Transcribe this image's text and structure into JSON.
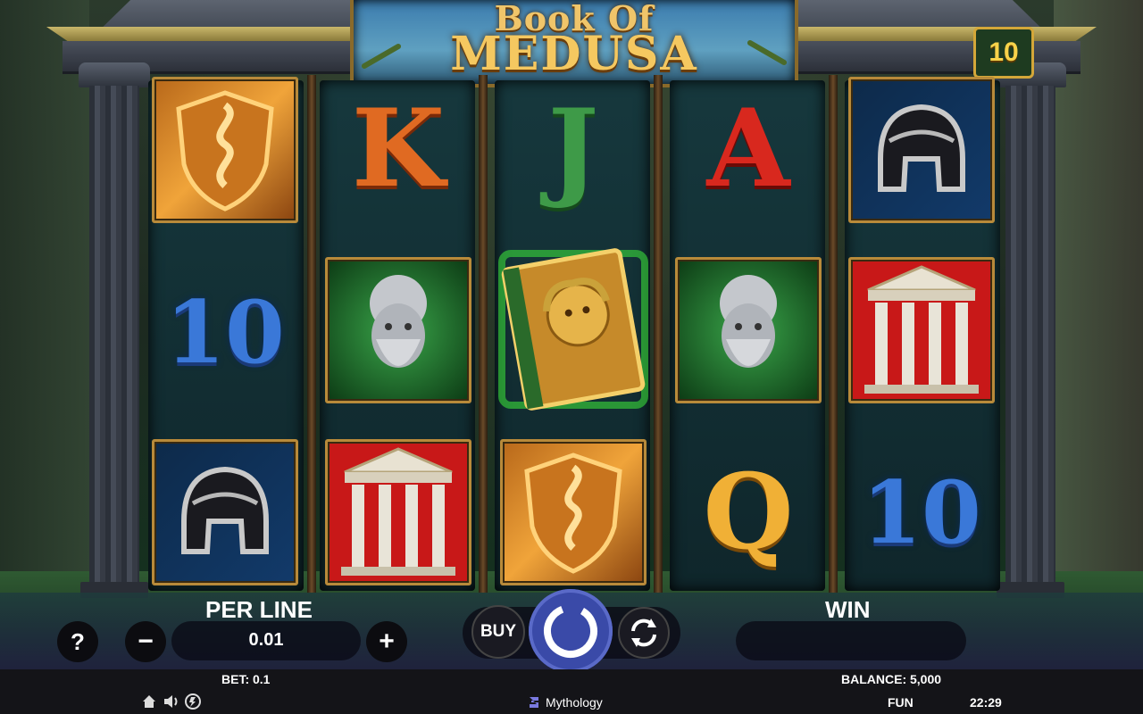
{
  "game": {
    "title_line1": "Book Of",
    "title_line2": "MEDUSA",
    "lines_count": "10"
  },
  "reels": [
    [
      "shield",
      "ten",
      "helmet"
    ],
    [
      "K",
      "bust",
      "temple"
    ],
    [
      "J",
      "book",
      "shield"
    ],
    [
      "A",
      "bust",
      "Q"
    ],
    [
      "helmet",
      "temple",
      "ten"
    ]
  ],
  "symbols": {
    "ten_label": "10"
  },
  "controls": {
    "help_label": "?",
    "minus_label": "−",
    "plus_label": "+",
    "per_line_label": "PER LINE",
    "per_line_value": "0.01",
    "buy_label": "BUY",
    "win_label": "WIN",
    "win_value": ""
  },
  "status": {
    "bet": "BET: 0.1",
    "balance": "BALANCE: 5,000",
    "mode": "FUN",
    "clock": "22:29",
    "brand": "Mythology"
  },
  "colors": {
    "gold": "#d4a739",
    "glow_green": "#3bdc3a",
    "red_pillar": "#c81818",
    "ten_blue": "#3a78d8"
  }
}
